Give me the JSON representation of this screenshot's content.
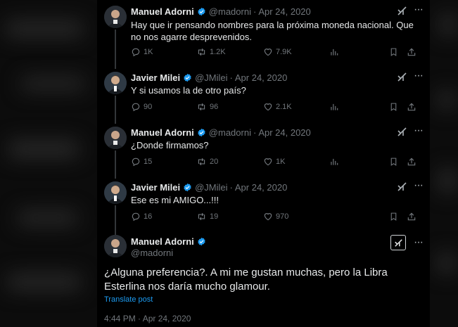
{
  "replies": [
    {
      "author": "Manuel Adorni",
      "handle": "@madorni",
      "sep": "·",
      "date": "Apr 24, 2020",
      "text": "Hay que ir pensando nombres para la próxima moneda nacional. Que no nos agarre desprevenidos.",
      "replies_count": "1K",
      "reposts_count": "1.2K",
      "likes_count": "7.9K",
      "views_count": ""
    },
    {
      "author": "Javier Milei",
      "handle": "@JMilei",
      "sep": "·",
      "date": "Apr 24, 2020",
      "text": "Y si usamos la de otro país?",
      "replies_count": "90",
      "reposts_count": "96",
      "likes_count": "2.1K",
      "views_count": ""
    },
    {
      "author": "Manuel Adorni",
      "handle": "@madorni",
      "sep": "·",
      "date": "Apr 24, 2020",
      "text": "¿Donde firmamos?",
      "replies_count": "15",
      "reposts_count": "20",
      "likes_count": "1K",
      "views_count": ""
    },
    {
      "author": "Javier Milei",
      "handle": "@JMilei",
      "sep": "·",
      "date": "Apr 24, 2020",
      "text": "Ese es mi AMIGO...!!!",
      "replies_count": "16",
      "reposts_count": "19",
      "likes_count": "970",
      "views_count": ""
    }
  ],
  "main": {
    "author": "Manuel Adorni",
    "handle": "@madorni",
    "text": "¿Alguna preferencia?. A mi me gustan muchas, pero la Libra Esterlina nos daría mucho glamour.",
    "translate_label": "Translate post",
    "timestamp": "4:44 PM · Apr 24, 2020"
  },
  "colors": {
    "background": "#000000",
    "text": "#e7e9ea",
    "secondary": "#71767b",
    "link": "#1d9bf0",
    "verified": "#1d9bf0"
  },
  "icons": {
    "verified": "verified-badge-icon",
    "grok": "grok-icon",
    "more": "more-icon",
    "reply": "reply-icon",
    "repost": "repost-icon",
    "like": "heart-icon",
    "views": "views-icon",
    "bookmark": "bookmark-icon",
    "share": "share-icon"
  }
}
